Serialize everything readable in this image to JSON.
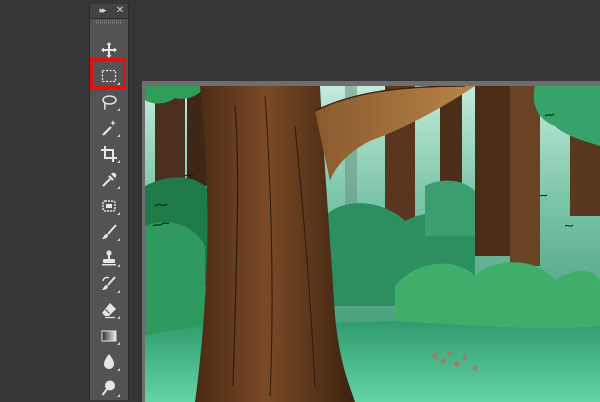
{
  "app": {
    "background_color": "#353535",
    "panel_color": "#535353",
    "highlight_color": "#e01010"
  },
  "tool_panel": {
    "collapse_icon": "double-chevron-right-icon",
    "close_icon": "close-icon",
    "tools": [
      {
        "name": "move-tool",
        "icon": "move-icon"
      },
      {
        "name": "rectangular-marquee-tool",
        "icon": "marquee-icon",
        "selected": true
      },
      {
        "name": "lasso-tool",
        "icon": "lasso-icon"
      },
      {
        "name": "magic-wand-tool",
        "icon": "magic-wand-icon"
      },
      {
        "name": "crop-tool",
        "icon": "crop-icon"
      },
      {
        "name": "eyedropper-tool",
        "icon": "eyedropper-icon"
      },
      {
        "name": "spot-healing-tool",
        "icon": "bandage-icon"
      },
      {
        "name": "brush-tool",
        "icon": "brush-icon"
      },
      {
        "name": "clone-stamp-tool",
        "icon": "stamp-icon"
      },
      {
        "name": "history-brush-tool",
        "icon": "history-brush-icon"
      },
      {
        "name": "eraser-tool",
        "icon": "eraser-icon"
      },
      {
        "name": "gradient-tool",
        "icon": "gradient-icon"
      },
      {
        "name": "blur-tool",
        "icon": "blur-icon"
      },
      {
        "name": "dodge-tool",
        "icon": "dodge-icon"
      }
    ]
  },
  "document": {
    "image_icon": "forest-illustration-icon"
  }
}
